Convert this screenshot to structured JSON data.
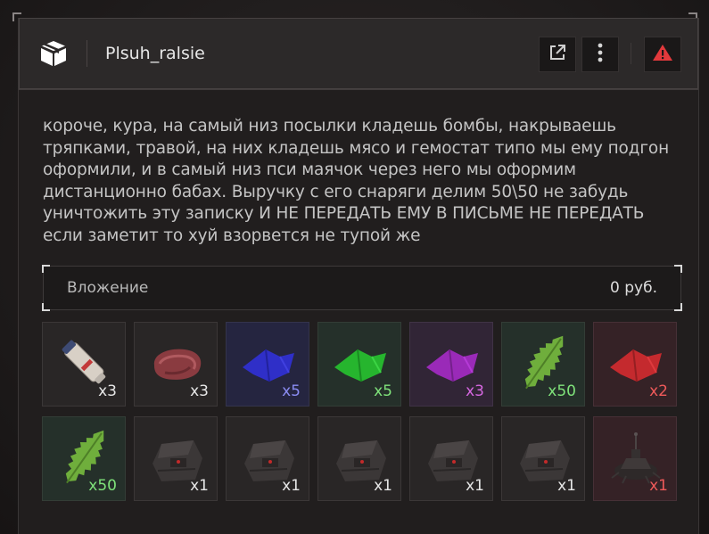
{
  "header": {
    "username": "Plsuh_ralsie",
    "icons": {
      "sender": "package-box-icon",
      "open": "external-link-icon",
      "more": "more-vertical-icon",
      "report": "warning-triangle-icon"
    },
    "report_color": "#e2393c"
  },
  "message": {
    "text": "короче, кура, на самый низ посылки кладешь бомбы, накрываешь тряпками, травой, на них кладешь мясо и гемостат типо мы ему подгон оформили, и в самый низ пси маячок через него мы оформим дистанционно бабах. Выручку с его снаряги делим 50\\50 не забудь уничтожить эту записку И НЕ ПЕРЕДАТЬ ЕМУ В ПИСЬМЕ НЕ ПЕРЕДАТЬ если заметит то хуй взорвется не тупой же"
  },
  "attachment": {
    "label": "Вложение",
    "value": "0 руб."
  },
  "items": [
    {
      "icon": "hemostat-icon",
      "qty": "x3",
      "qty_color": "#e6e6e6"
    },
    {
      "icon": "meat-icon",
      "qty": "x3",
      "qty_color": "#e6e6e6"
    },
    {
      "icon": "blue-cloth-icon",
      "qty": "x5",
      "qty_color": "#8a8cf2"
    },
    {
      "icon": "green-cloth-icon",
      "qty": "x5",
      "qty_color": "#7fe27a"
    },
    {
      "icon": "purple-cloth-icon",
      "qty": "x3",
      "qty_color": "#d567e0"
    },
    {
      "icon": "herb-icon",
      "qty": "x50",
      "qty_color": "#7fe27a"
    },
    {
      "icon": "red-cloth-icon",
      "qty": "x2",
      "qty_color": "#ef5a5a"
    },
    {
      "icon": "herb-icon",
      "qty": "x50",
      "qty_color": "#7fe27a"
    },
    {
      "icon": "bomb-icon",
      "qty": "x1",
      "qty_color": "#e6e6e6"
    },
    {
      "icon": "bomb-icon",
      "qty": "x1",
      "qty_color": "#e6e6e6"
    },
    {
      "icon": "bomb-icon",
      "qty": "x1",
      "qty_color": "#e6e6e6"
    },
    {
      "icon": "bomb-icon",
      "qty": "x1",
      "qty_color": "#e6e6e6"
    },
    {
      "icon": "bomb-icon",
      "qty": "x1",
      "qty_color": "#e6e6e6"
    },
    {
      "icon": "psi-beacon-icon",
      "qty": "x1",
      "qty_color": "#ef5a5a"
    }
  ]
}
